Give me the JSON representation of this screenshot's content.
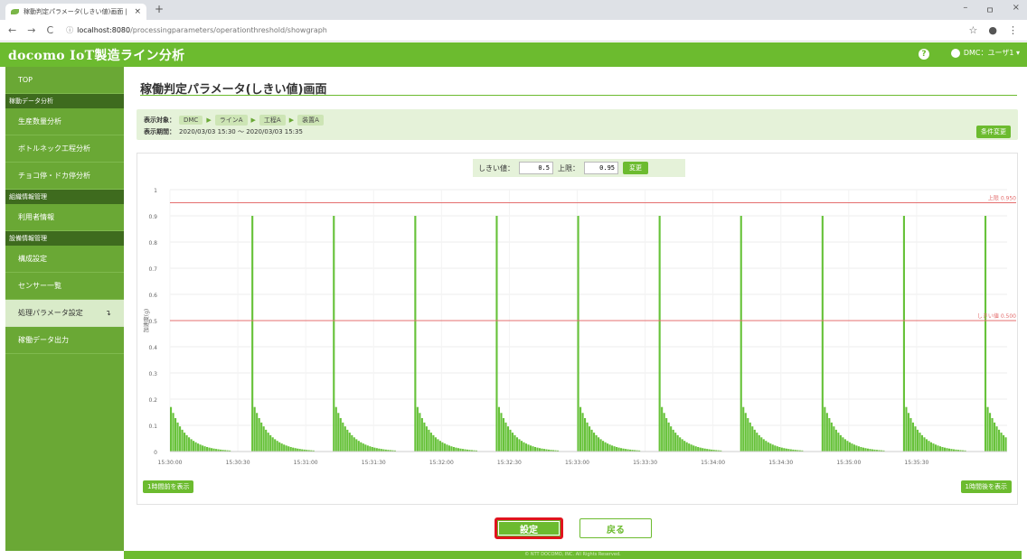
{
  "browser": {
    "tab_title": "稼動判定パラメータ(しきい値)画面 |",
    "tab_close": "×",
    "new_tab": "+",
    "nav": {
      "back": "←",
      "forward": "→",
      "reload": "C"
    },
    "url_host": "localhost:8080",
    "url_path": "/processingparameters/operationthreshold/showgraph",
    "info_icon": "ⓘ",
    "star": "☆",
    "profile": "●",
    "menu": "⋮",
    "window": {
      "min": "–",
      "max": "ㅁ",
      "close": "×"
    }
  },
  "header": {
    "title": "docomo IoT製造ライン分析",
    "help": "?",
    "user": "DMC：ユーザ1 ▾"
  },
  "sidebar": {
    "top": "TOP",
    "sections": [
      {
        "heading": "稼動データ分析",
        "items": [
          "生産数量分析",
          "ボトルネック工程分析",
          "チョコ停・ドカ停分析"
        ]
      },
      {
        "heading": "組織情報管理",
        "items": [
          "利用者情報"
        ]
      },
      {
        "heading": "設備情報管理",
        "items": [
          "構成設定",
          "センサー一覧",
          "処理パラメータ設定",
          "稼働データ出力"
        ]
      }
    ],
    "active_item": "処理パラメータ設定",
    "active_marker": "↴"
  },
  "page": {
    "title": "稼働判定パラメータ(しきい値)画面",
    "target_label": "表示対象：",
    "path": [
      "DMC",
      "ラインA",
      "工程A",
      "装置A"
    ],
    "period_label": "表示期間：",
    "period_value": "2020/03/03 15:30 ～ 2020/03/03 15:35",
    "change_condition": "条件変更",
    "threshold_label": "しきい値：",
    "threshold_value": "0.5",
    "upper_label": "上限：",
    "upper_value": "0.95",
    "apply_button": "変更",
    "prev_hour": "1時間前を表示",
    "next_hour": "1時間後を表示",
    "set_button": "設定",
    "back_button": "戻る",
    "footer": "© NTT DOCOMO, INC. All Rights Reserved."
  },
  "colors": {
    "brand": "#6cbb2f",
    "sidebar": "#6aa835",
    "line": "#e46f6f",
    "bar": "#67c23a"
  },
  "chart_data": {
    "type": "bar",
    "ylabel": "加速度(g)",
    "ylim": [
      0,
      1
    ],
    "yticks": [
      0,
      0.1,
      0.2,
      0.3,
      0.4,
      0.5,
      0.6,
      0.7,
      0.8,
      0.9,
      1
    ],
    "xticks": [
      "15:30:00",
      "15:30:30",
      "15:31:00",
      "15:31:30",
      "15:32:00",
      "15:32:30",
      "15:33:00",
      "15:33:30",
      "15:34:00",
      "15:34:30",
      "15:35:00",
      "15:35:30"
    ],
    "x_range_seconds": [
      0,
      370
    ],
    "cycles": [
      {
        "spike_x": 0,
        "spike_peak": 0.17
      },
      {
        "spike_x": 36,
        "spike_peak": 0.9
      },
      {
        "spike_x": 72,
        "spike_peak": 0.9
      },
      {
        "spike_x": 108,
        "spike_peak": 0.9
      },
      {
        "spike_x": 144,
        "spike_peak": 0.9
      },
      {
        "spike_x": 180,
        "spike_peak": 0.9
      },
      {
        "spike_x": 216,
        "spike_peak": 0.9
      },
      {
        "spike_x": 252,
        "spike_peak": 0.9
      },
      {
        "spike_x": 288,
        "spike_peak": 0.9
      },
      {
        "spike_x": 324,
        "spike_peak": 0.9
      },
      {
        "spike_x": 360,
        "spike_peak": 0.9
      }
    ],
    "decay_start": 0.17,
    "thresholds": [
      {
        "label": "上限",
        "value": 0.95,
        "text": "上限 0.950"
      },
      {
        "label": "しきい値",
        "value": 0.5,
        "text": "しきい値 0.500"
      }
    ]
  }
}
